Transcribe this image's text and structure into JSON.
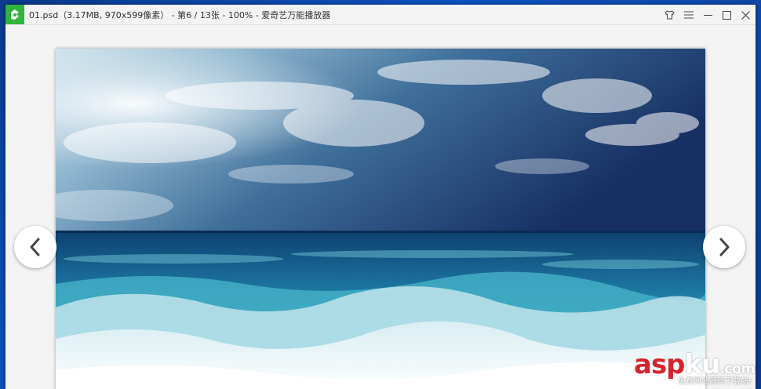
{
  "window": {
    "title": "01.psd（3.17MB, 970x599像素） - 第6 / 13张 - 100% - 爱奇艺万能播放器"
  },
  "titlebar": {
    "icons": [
      "app-logo-icon",
      "skin-shirt-icon",
      "menu-icon",
      "minimize-icon",
      "maximize-icon",
      "close-icon"
    ]
  },
  "viewer": {
    "prev_icon": "chevron-left-icon",
    "next_icon": "chevron-right-icon",
    "image_subject": "ocean-waves-photo"
  },
  "watermark": {
    "main_red": "asp",
    "main_white": "ku",
    "suffix": ".com",
    "sub": "免费网站源码下载站!"
  },
  "colors": {
    "app_icon_bg": "#2fb43a",
    "titlebar_bg": "#f3f3f3",
    "viewer_bg": "#f3f3f3",
    "watermark_red": "#d8222a"
  }
}
